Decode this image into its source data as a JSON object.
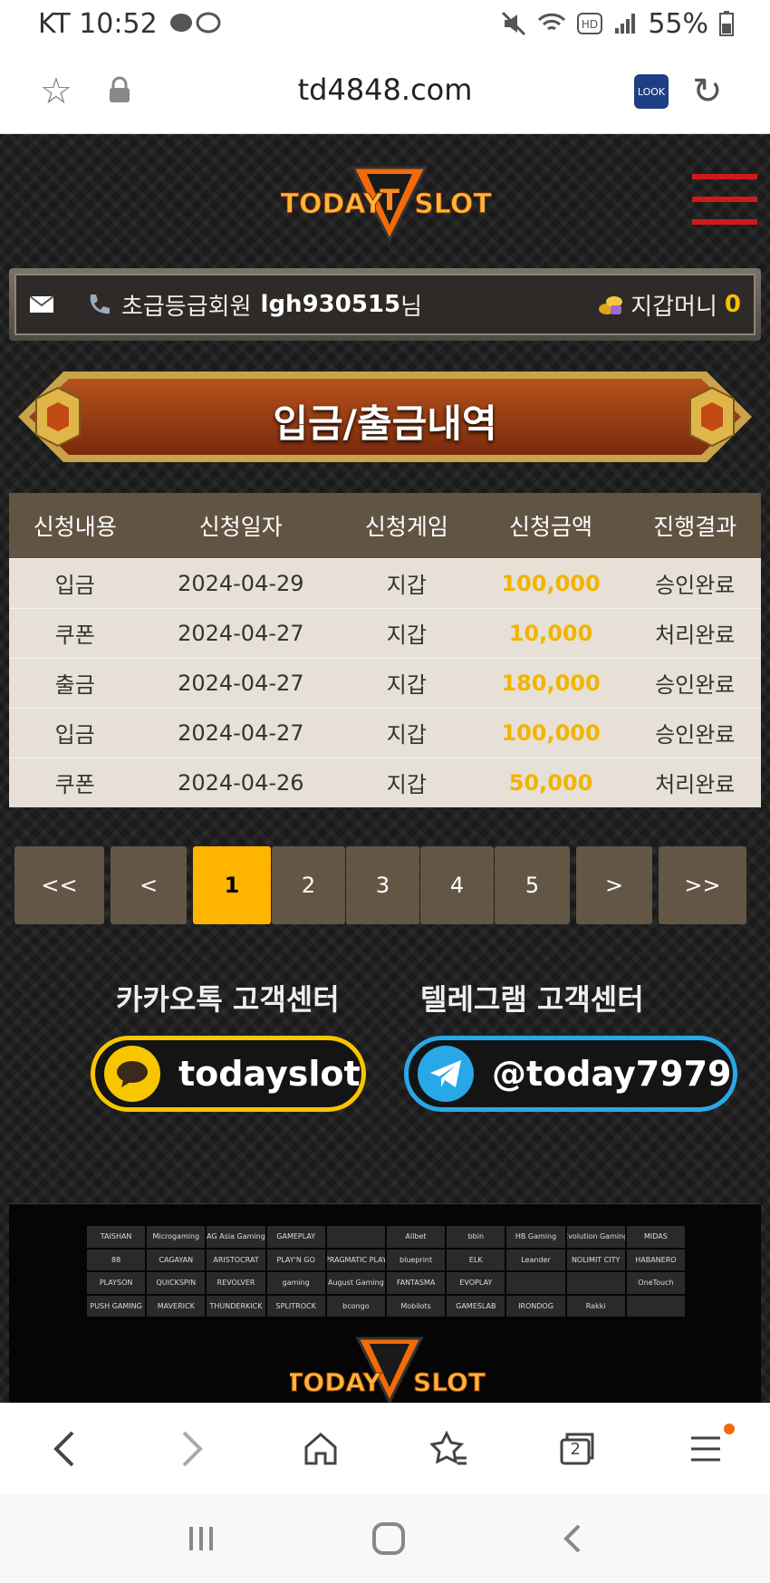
{
  "status": {
    "carrier_time": "KT 10:52",
    "battery": "55%"
  },
  "browser": {
    "url": "td4848.com",
    "look_label": "LOOK"
  },
  "brand": {
    "logo_left": "TODAY",
    "logo_right": "SLOT"
  },
  "member": {
    "grade": "초급등급회원",
    "username": "lgh930515",
    "suffix": "님",
    "money_label": "지갑머니",
    "money_value": "0"
  },
  "page_title": "입금/출금내역",
  "table": {
    "headers": [
      "신청내용",
      "신청일자",
      "신청게임",
      "신청금액",
      "진행결과"
    ],
    "rows": [
      [
        "입금",
        "2024-04-29",
        "지갑",
        "100,000",
        "승인완료"
      ],
      [
        "쿠폰",
        "2024-04-27",
        "지갑",
        "10,000",
        "처리완료"
      ],
      [
        "출금",
        "2024-04-27",
        "지갑",
        "180,000",
        "승인완료"
      ],
      [
        "입금",
        "2024-04-27",
        "지갑",
        "100,000",
        "승인완료"
      ],
      [
        "쿠폰",
        "2024-04-26",
        "지갑",
        "50,000",
        "처리완료"
      ]
    ]
  },
  "pagination": {
    "first": "<<",
    "prev": "<",
    "pages": [
      "1",
      "2",
      "3",
      "4",
      "5"
    ],
    "current": "1",
    "next": ">",
    "last": ">>"
  },
  "support": {
    "kakao_title": "카카오톡 고객센터",
    "kakao_id": "todayslot",
    "telegram_title": "텔레그램 고객센터",
    "telegram_id": "@today7979"
  },
  "providers": [
    "TAISHAN",
    "Microgaming",
    "AG Asia Gaming",
    "GAMEPLAY",
    "",
    "Allbet",
    "bbin",
    "HB Gaming",
    "Evolution Gaming",
    "MIDAS",
    "88",
    "CAGAYAN",
    "ARISTOCRAT",
    "PLAY'N GO",
    "PRAGMATIC PLAY",
    "blueprint",
    "ELK",
    "Leander",
    "NOLIMIT CITY",
    "HABANERO",
    "PLAYSON",
    "QUICKSPIN",
    "REVOLVER",
    "gaming",
    "August Gaming",
    "FANTASMA",
    "EVOPLAY",
    "",
    "",
    "OneTouch",
    "PUSH GAMING",
    "MAVERICK",
    "THUNDERKICK",
    "SPLITROCK",
    "bcongo",
    "Mobilots",
    "GAMESLAB",
    "IRONDOG",
    "Rakki",
    ""
  ],
  "nav": {
    "tabs_count": "2"
  },
  "colors": {
    "amount": "#f2b400",
    "kakao": "#f7c600",
    "telegram": "#29a8e8",
    "active_page": "#ffb400",
    "table_header": "#625443"
  }
}
